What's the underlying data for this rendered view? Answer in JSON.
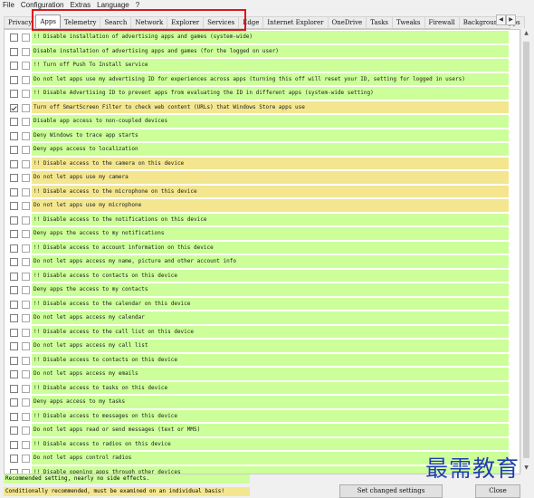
{
  "menu": {
    "items": [
      "File",
      "Configuration",
      "Extras",
      "Language",
      "?"
    ]
  },
  "tabs": [
    {
      "label": "Privacy",
      "active": false
    },
    {
      "label": "Apps",
      "active": true
    },
    {
      "label": "Telemetry",
      "active": false
    },
    {
      "label": "Search",
      "active": false
    },
    {
      "label": "Network",
      "active": false
    },
    {
      "label": "Explorer",
      "active": false
    },
    {
      "label": "Services",
      "active": false
    },
    {
      "label": "Edge",
      "active": false
    },
    {
      "label": "Internet Explorer",
      "active": false
    },
    {
      "label": "OneDrive",
      "active": false
    },
    {
      "label": "Tasks",
      "active": false
    },
    {
      "label": "Tweaks",
      "active": false
    },
    {
      "label": "Firewall",
      "active": false
    },
    {
      "label": "Background-Apps",
      "active": false
    }
  ],
  "tab_scroll": {
    "left": "◀",
    "right": "▶"
  },
  "settings": [
    {
      "label": "!! Disable installation of advertising apps and games (system-wide)",
      "category": "green",
      "checked": false
    },
    {
      "label": "Disable installation of advertising apps and games (for the logged on user)",
      "category": "green",
      "checked": false
    },
    {
      "label": "!! Turn off Push To Install service",
      "category": "green",
      "checked": false
    },
    {
      "label": "Do not let apps use my advertising ID for experiences across apps (turning this off will reset your ID, setting for logged in users)",
      "category": "green",
      "checked": false
    },
    {
      "label": "!! Disable Advertising ID to prevent apps from evaluating the ID in different apps (system-wide setting)",
      "category": "green",
      "checked": false
    },
    {
      "label": "Turn off SmartScreen Filter to check web content (URLs) that Windows Store apps use",
      "category": "yellow",
      "checked": true
    },
    {
      "label": "Disable app access to non-coupled devices",
      "category": "green",
      "checked": false
    },
    {
      "label": "Deny Windows to trace app starts",
      "category": "green",
      "checked": false
    },
    {
      "label": "Deny apps access to localization",
      "category": "green",
      "checked": false
    },
    {
      "label": "!! Disable access to the camera on this device",
      "category": "yellow",
      "checked": false
    },
    {
      "label": "Do not let apps use my camera",
      "category": "yellow",
      "checked": false
    },
    {
      "label": "!! Disable access to the microphone on this device",
      "category": "yellow",
      "checked": false
    },
    {
      "label": "Do not let apps use my microphone",
      "category": "yellow",
      "checked": false
    },
    {
      "label": "!! Disable access to the notifications on this device",
      "category": "green",
      "checked": false
    },
    {
      "label": "Deny apps the access to my notifications",
      "category": "green",
      "checked": false
    },
    {
      "label": "!! Disable access to account information on this device",
      "category": "green",
      "checked": false
    },
    {
      "label": "Do not let apps access my name, picture and other account info",
      "category": "green",
      "checked": false
    },
    {
      "label": "!! Disable access to contacts on this device",
      "category": "green",
      "checked": false
    },
    {
      "label": "Deny apps the access to my contacts",
      "category": "green",
      "checked": false
    },
    {
      "label": "!! Disable access to the calendar on this device",
      "category": "green",
      "checked": false
    },
    {
      "label": "Do not let apps access my calendar",
      "category": "green",
      "checked": false
    },
    {
      "label": "!! Disable access to the call list on this device",
      "category": "green",
      "checked": false
    },
    {
      "label": "Do not let apps access my call list",
      "category": "green",
      "checked": false
    },
    {
      "label": "!! Disable access to contacts on this device",
      "category": "green",
      "checked": false
    },
    {
      "label": "Do not let apps access my emails",
      "category": "green",
      "checked": false
    },
    {
      "label": "!! Disable access to tasks on this device",
      "category": "green",
      "checked": false
    },
    {
      "label": "Deny apps access to my tasks",
      "category": "green",
      "checked": false
    },
    {
      "label": "!! Disable access to messages on this device",
      "category": "green",
      "checked": false
    },
    {
      "label": "Do not let apps read or send messages (text or MMS)",
      "category": "green",
      "checked": false
    },
    {
      "label": "!! Disable access to radios on this device",
      "category": "green",
      "checked": false
    },
    {
      "label": "Do not let apps control radios",
      "category": "green",
      "checked": false
    },
    {
      "label": "!! Disable opening apps through other devices",
      "category": "green",
      "checked": false
    }
  ],
  "legend": {
    "recommended": "Recommended setting, nearly no side effects.",
    "conditional": "Conditionally recommended, must be examined on an individual basis!"
  },
  "buttons": {
    "apply": "Set changed settings",
    "close": "Close"
  },
  "watermark": "最需教育",
  "colors": {
    "recommended": "#ccff99",
    "conditional": "#f3e68f",
    "highlight": "#e0141c"
  }
}
